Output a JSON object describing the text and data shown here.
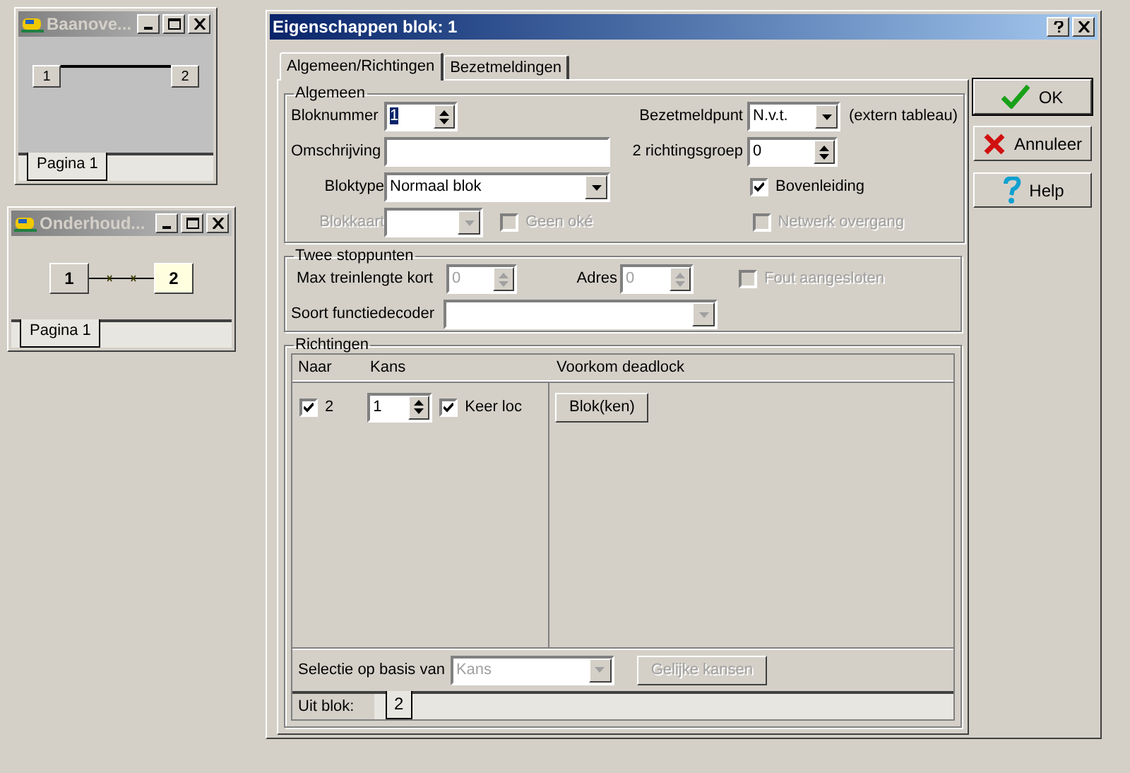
{
  "windows": [
    {
      "title": "Baanove...",
      "kind": "plain",
      "nodes": [
        {
          "label": "1",
          "highlighted": false
        },
        {
          "label": "2",
          "highlighted": false
        }
      ],
      "page_tabs": [
        {
          "label": "Pagina 1",
          "selected": true
        }
      ]
    },
    {
      "title": "Onderhoud...",
      "kind": "marked",
      "nodes": [
        {
          "label": "1",
          "highlighted": false
        },
        {
          "label": "2",
          "highlighted": true
        }
      ],
      "page_tabs": [
        {
          "label": "Pagina 1",
          "selected": true
        }
      ]
    }
  ],
  "dialog": {
    "title": "Eigenschappen blok: 1",
    "tabs": [
      {
        "label": "Algemeen/Richtingen",
        "selected": true
      },
      {
        "label": "Bezetmeldingen",
        "selected": false
      }
    ],
    "algemeen": {
      "legend": "Algemeen",
      "bloknummer": {
        "label": "Bloknummer",
        "value": "1",
        "text_selected": true
      },
      "omschrijving": {
        "label": "Omschrijving"
      },
      "bloktype": {
        "label": "Bloktype",
        "value": "Normaal blok"
      },
      "blokkaart": {
        "label": "Blokkaart",
        "disabled": true
      },
      "geen_oke": {
        "label": "Geen oké",
        "checked": false,
        "disabled": true
      },
      "bezetmeldpunt": {
        "label": "Bezetmeldpunt",
        "value": "N.v.t.",
        "note": "(extern tableau)"
      },
      "richtingsgroep": {
        "label": "2 richtingsgroep",
        "value": "0"
      },
      "bovenleiding": {
        "label": "Bovenleiding",
        "checked": true,
        "disabled": false
      },
      "netwerk_overgang": {
        "label": "Netwerk overgang",
        "checked": false,
        "disabled": true
      }
    },
    "twee_stoppunten": {
      "legend": "Twee stoppunten",
      "max_treinlengte": {
        "label": "Max treinlengte kort",
        "value": "0",
        "disabled": true
      },
      "adres": {
        "label": "Adres",
        "value": "0",
        "disabled": true
      },
      "fout_aangesloten": {
        "label": "Fout aangesloten",
        "checked": false,
        "disabled": true
      },
      "functiedecoder": {
        "label": "Soort functiedecoder",
        "disabled": true
      }
    },
    "richtingen": {
      "legend": "Richtingen",
      "columns": [
        "Naar",
        "Kans",
        "Voorkom deadlock"
      ],
      "rows": [
        {
          "naar": "2",
          "naar_checked": true,
          "kans": "1",
          "keer_loc": {
            "label": "Keer loc",
            "checked": true
          },
          "deadlock_button": "Blok(ken)"
        }
      ],
      "selectie": {
        "label": "Selectie op basis van",
        "value": "Kans",
        "disabled": true
      },
      "gelijke_kansen": {
        "label": "Gelijke kansen",
        "disabled": true
      },
      "uit_blok": {
        "label": "Uit blok:",
        "tabs": [
          {
            "label": "2",
            "selected": true
          }
        ]
      }
    },
    "buttons": [
      {
        "label": "OK",
        "kind": "ok",
        "default": true
      },
      {
        "label": "Annuleer",
        "kind": "cancel",
        "default": false
      },
      {
        "label": "Help",
        "kind": "help",
        "default": false
      }
    ]
  }
}
